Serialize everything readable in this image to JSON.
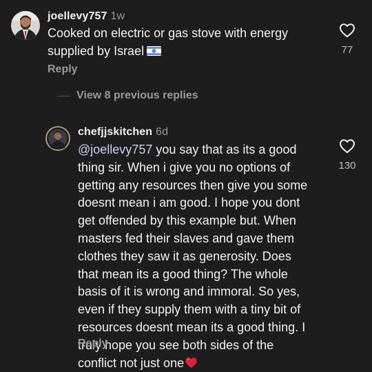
{
  "comment1": {
    "username": "joellevy757",
    "time": "1w",
    "text": "Cooked on electric or gas stove with energy\nsupplied by Israel",
    "flag_icon": "israel-flag-icon",
    "like_icon": "heart-outline-icon",
    "likes": "77",
    "reply_label": "Reply"
  },
  "view_replies": {
    "label": "View 8 previous replies"
  },
  "comment2": {
    "username": "chefjjskitchen",
    "time": "6d",
    "mention": "@joellevy757",
    "text_after_mention": " you say that as its a good\nthing sir. When i give you no options of\ngetting any resources then give you some\ndoesnt mean i am good. I hope you dont\nget offended by this example but. When\nmasters fed their slaves and gave them\nclothes they saw it as generosity. Does\nthat mean its a good thing? The whole\nbasis of it is wrong and immoral. So yes,\neven if they supply them with a tiny bit of\nresources doesnt mean its a good thing. I\ntruly hope you see both sides of the\nconflict not just one",
    "emoji_icon": "red-heart-emoji",
    "like_icon": "heart-outline-icon",
    "likes": "130",
    "reply_label": "Reply"
  },
  "colors": {
    "background": "#1d1d1d",
    "text": "#f2f2f2",
    "secondary_text": "#9a9a9a",
    "heart_emoji": "#e0213a",
    "story_ring": "#b2a07a"
  }
}
